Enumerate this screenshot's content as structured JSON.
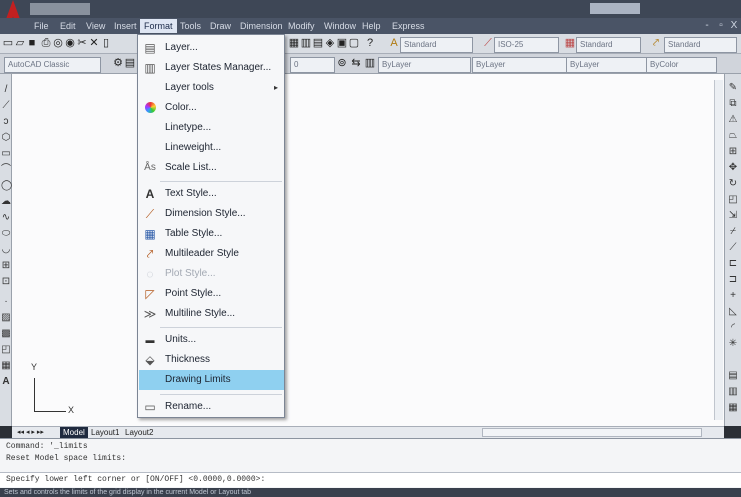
{
  "window": {
    "minimize": "-",
    "restore": "▫",
    "close": "X"
  },
  "menubar": [
    "File",
    "Edit",
    "View",
    "Insert",
    "Format",
    "Tools",
    "Draw",
    "Dimension",
    "Modify",
    "Window",
    "Help",
    "Express"
  ],
  "toolbar": {
    "text_style": "Standard",
    "dim_style": "ISO-25",
    "table_style": "Standard",
    "mleader_style": "Standard",
    "workspace": "AutoCAD Classic",
    "layer": "0",
    "color": "ByLayer",
    "linetype": "ByLayer",
    "lineweight": "ByLayer",
    "plotstyle": "ByColor"
  },
  "format_menu": [
    {
      "label": "Layer...",
      "icon": "layer-icon"
    },
    {
      "label": "Layer States Manager...",
      "icon": "layer-states-icon"
    },
    {
      "label": "Layer tools",
      "icon": "",
      "submenu": true
    },
    {
      "label": "Color...",
      "icon": "color-wheel-icon"
    },
    {
      "label": "Linetype...",
      "icon": ""
    },
    {
      "label": "Lineweight...",
      "icon": ""
    },
    {
      "label": "Scale List...",
      "icon": "scale-list-icon"
    },
    {
      "label": "Text Style...",
      "icon": "text-style-icon"
    },
    {
      "label": "Dimension Style...",
      "icon": "dimension-style-icon"
    },
    {
      "label": "Table Style...",
      "icon": "table-style-icon"
    },
    {
      "label": "Multileader Style",
      "icon": "multileader-style-icon"
    },
    {
      "label": "Plot Style...",
      "icon": "plot-style-icon",
      "disabled": true
    },
    {
      "label": "Point Style...",
      "icon": "point-style-icon"
    },
    {
      "label": "Multiline Style...",
      "icon": "multiline-style-icon"
    },
    {
      "label": "Units...",
      "icon": "units-icon"
    },
    {
      "label": "Thickness",
      "icon": "thickness-icon"
    },
    {
      "label": "Drawing Limits",
      "icon": "",
      "highlighted": true
    },
    {
      "label": "Rename...",
      "icon": "rename-icon"
    }
  ],
  "ucs": {
    "x": "X",
    "y": "Y"
  },
  "tabs": [
    "Model",
    "Layout1",
    "Layout2"
  ],
  "command": {
    "lines": [
      "Command: '_limits",
      "Reset Model space limits:",
      "Specify lower left corner or [ON/OFF] <0.0000,0.0000>:"
    ]
  },
  "status_text": "Sets and controls the limits of the grid display in the current Model or Layout tab"
}
